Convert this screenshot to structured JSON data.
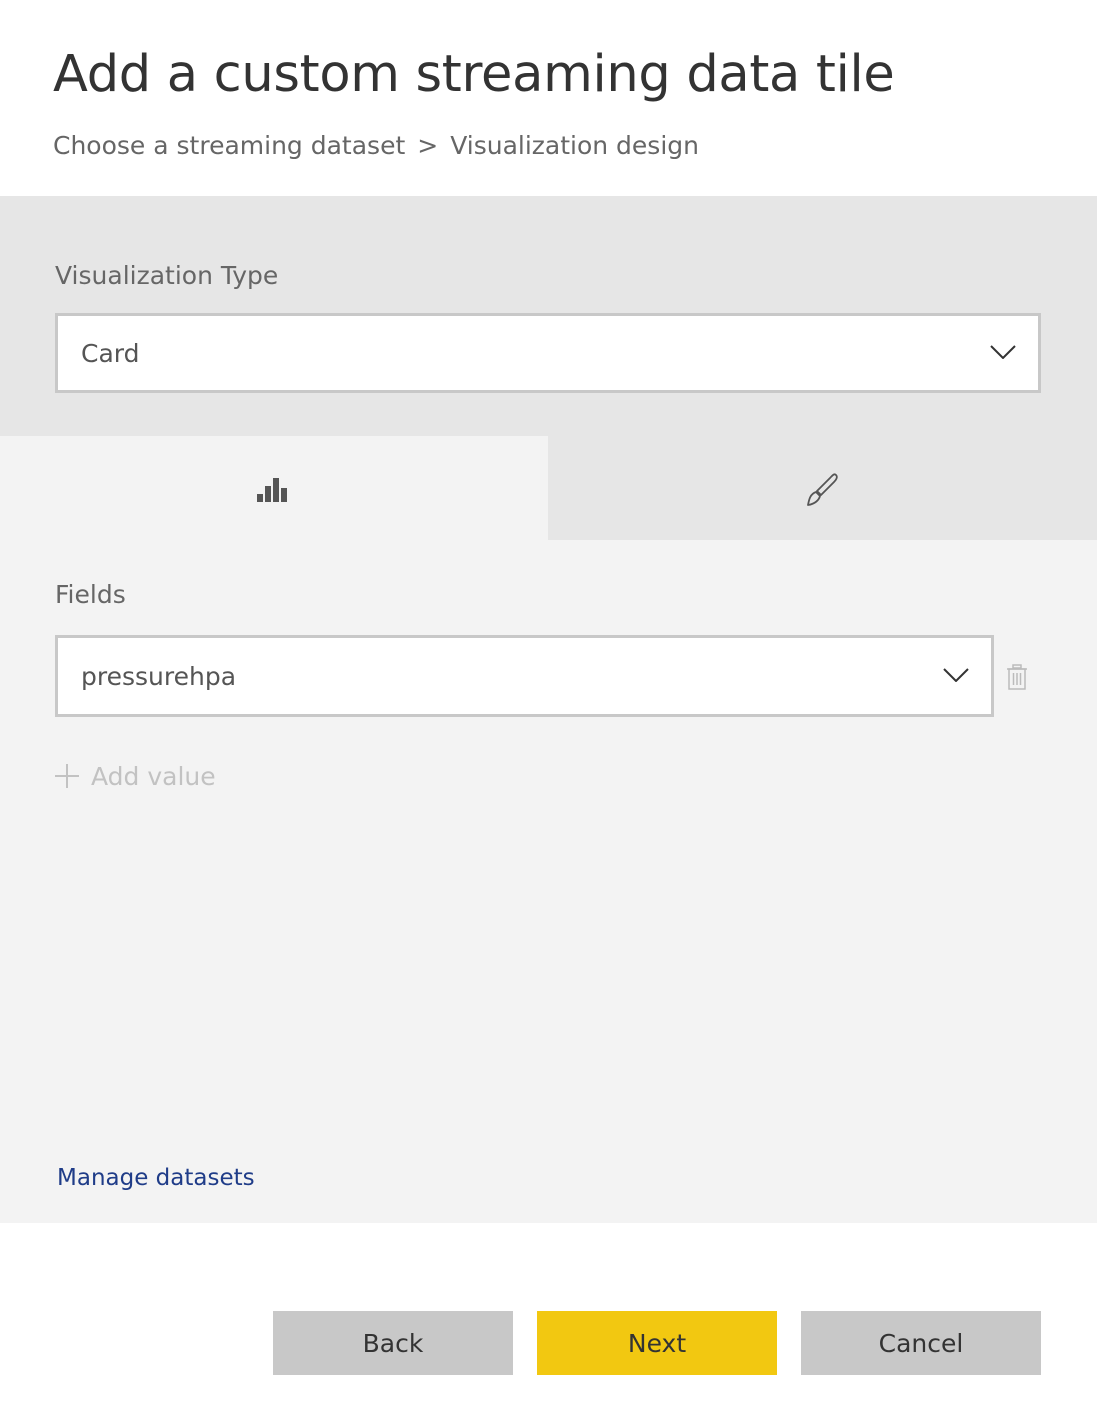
{
  "dialog": {
    "title": "Add a custom streaming data tile",
    "breadcrumb": {
      "step1": "Choose a streaming dataset",
      "separator": ">",
      "step2": "Visualization design"
    }
  },
  "visualization": {
    "label": "Visualization Type",
    "selected": "Card"
  },
  "tabs": [
    {
      "icon": "bar-chart-icon",
      "active": true
    },
    {
      "icon": "paintbrush-icon",
      "active": false
    }
  ],
  "fields": {
    "label": "Fields",
    "selected": "pressurehpa",
    "add_value_label": "Add value"
  },
  "links": {
    "manage_datasets": "Manage datasets"
  },
  "buttons": {
    "back": "Back",
    "next": "Next",
    "cancel": "Cancel"
  },
  "colors": {
    "accent": "#F2C811",
    "link": "#1F3C88",
    "panel": "#E6E6E6",
    "content": "#F3F3F3",
    "secondary_button": "#C8C8C8"
  }
}
